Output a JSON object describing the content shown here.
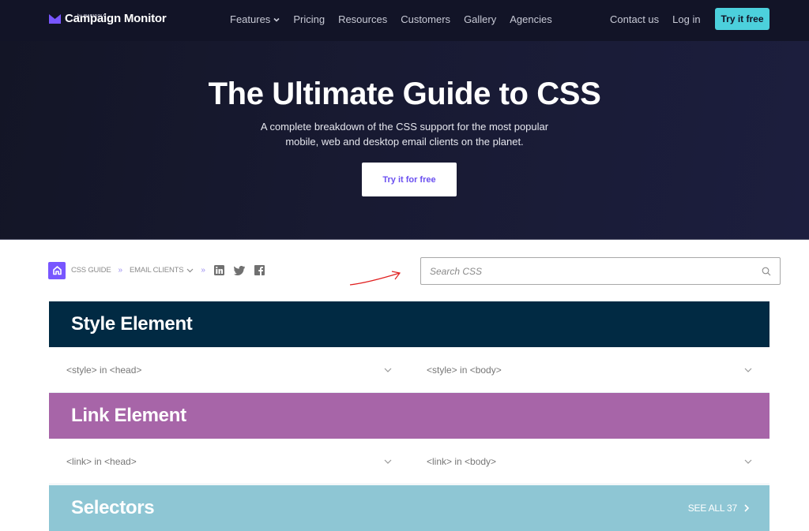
{
  "header": {
    "brand": "Campaign Monitor",
    "brand_sub": "by MARIGOLD",
    "nav": [
      {
        "label": "Features",
        "has_dropdown": true
      },
      {
        "label": "Pricing"
      },
      {
        "label": "Resources"
      },
      {
        "label": "Customers"
      },
      {
        "label": "Gallery"
      },
      {
        "label": "Agencies"
      }
    ],
    "contact_label": "Contact us",
    "login_label": "Log in",
    "cta_label": "Try it free"
  },
  "hero": {
    "title": "The Ultimate Guide to CSS",
    "subtitle": "A complete breakdown of the CSS support for the most popular mobile, web and desktop email clients on the planet.",
    "cta_label": "Try it for free"
  },
  "breadcrumb": {
    "items": [
      "CSS GUIDE",
      "EMAIL CLIENTS"
    ],
    "separator": "»",
    "social": [
      "linkedin-icon",
      "twitter-icon",
      "facebook-icon"
    ]
  },
  "search": {
    "placeholder": "Search CSS",
    "value": ""
  },
  "sections": [
    {
      "title": "Style Element",
      "color": "#012a43",
      "items": [
        "<style> in <head>",
        "<style> in <body>"
      ]
    },
    {
      "title": "Link Element",
      "color": "#a765a8",
      "items": [
        "<link> in <head>",
        "<link> in <body>"
      ]
    },
    {
      "title": "Selectors",
      "color": "#8ec6d4",
      "see_all_label": "SEE ALL 37"
    }
  ],
  "colors": {
    "topbar": "#121427",
    "accent_cyan": "#4cd0dc",
    "accent_purple": "#7856ff"
  }
}
